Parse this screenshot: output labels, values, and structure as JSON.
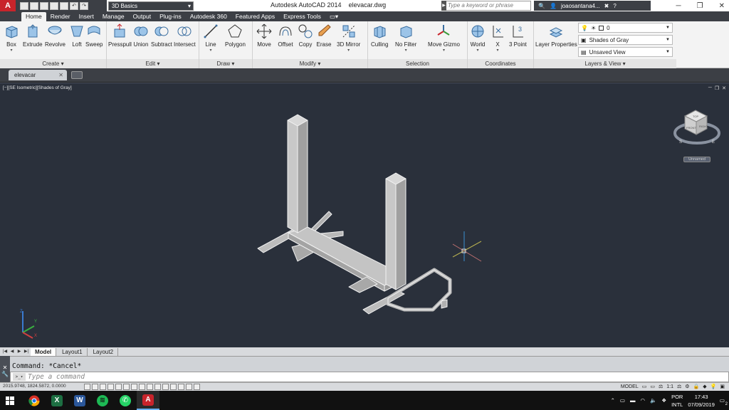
{
  "window": {
    "app_title": "Autodesk AutoCAD 2014",
    "file_name": "elevacar.dwg",
    "workspace": "3D Basics",
    "search_placeholder": "Type a keyword or phrase",
    "user": "joaosantana4..."
  },
  "ribbon_tabs": [
    "Home",
    "Render",
    "Insert",
    "Manage",
    "Output",
    "Plug-ins",
    "Autodesk 360",
    "Featured Apps",
    "Express Tools"
  ],
  "active_tab": "Home",
  "panels": {
    "create": {
      "title": "Create",
      "buttons": [
        "Box",
        "Extrude",
        "Revolve",
        "Loft",
        "Sweep"
      ]
    },
    "edit": {
      "title": "Edit",
      "buttons": [
        "Presspull",
        "Union",
        "Subtract",
        "Intersect"
      ]
    },
    "draw": {
      "title": "Draw",
      "buttons": [
        "Line",
        "Polygon"
      ]
    },
    "modify": {
      "title": "Modify",
      "buttons": [
        "Move",
        "Offset",
        "Copy",
        "Erase",
        "3D Mirror"
      ]
    },
    "selection": {
      "title": "Selection",
      "buttons": [
        "Culling",
        "No Filter",
        "Move Gizmo"
      ]
    },
    "coordinates": {
      "title": "Coordinates",
      "buttons": [
        "World",
        "X",
        "3 Point"
      ]
    },
    "layers": {
      "title": "Layers & View",
      "button": "Layer Properties",
      "layer_value": "0",
      "visual_style": "Shades of Gray",
      "view": "Unsaved View"
    }
  },
  "document_tab": "elevacar",
  "viewport": {
    "label": "[−][SE Isometric][Shades of Gray]",
    "viewcube_label": "Unnamed",
    "viewcube_faces": [
      "TOP",
      "FRONT",
      "RIGHT"
    ]
  },
  "layout_tabs": [
    "Model",
    "Layout1",
    "Layout2"
  ],
  "active_layout": "Model",
  "command": {
    "history": "Command: *Cancel*",
    "placeholder": "Type a command"
  },
  "status": {
    "coordinates": "2015.9748, 1824.5872, 0.0000",
    "model": "MODEL",
    "scale": "1:1"
  },
  "taskbar": {
    "apps": [
      "chrome",
      "excel",
      "word",
      "spotify",
      "whatsapp",
      "autocad"
    ],
    "active_app": "autocad",
    "language": "POR",
    "keyboard": "INTL",
    "time": "17:43",
    "date": "07/09/2019",
    "notifications": "2"
  },
  "colors": {
    "viewport_bg": "#2a303b",
    "ribbon_bg": "#f3f3f3",
    "tab_bar": "#3c3f45",
    "app_red": "#c8242b"
  }
}
